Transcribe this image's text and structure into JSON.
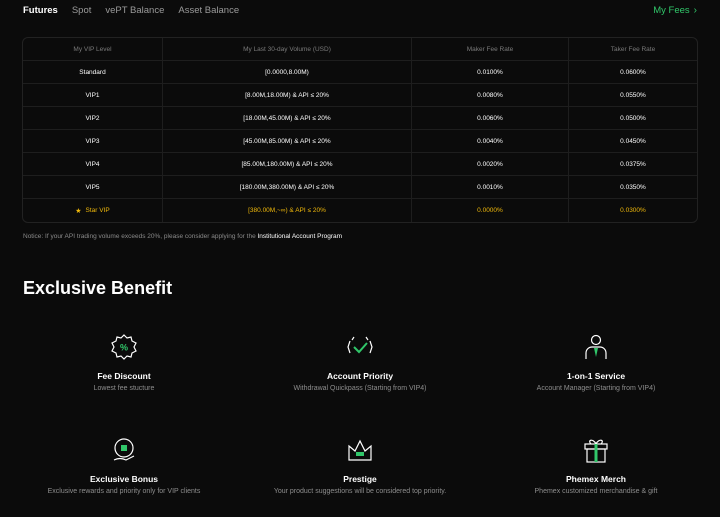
{
  "tabs": [
    "Futures",
    "Spot",
    "vePT Balance",
    "Asset Balance"
  ],
  "my_fees": "My Fees",
  "table": {
    "headers": [
      "My VIP Level",
      "My Last 30-day Volume (USD)",
      "Maker Fee Rate",
      "Taker Fee Rate"
    ],
    "rows": [
      [
        "Standard",
        "[0.0000,8.00M)",
        "0.0100%",
        "0.0600%"
      ],
      [
        "VIP1",
        "[8.00M,18.00M) & API ≤ 20%",
        "0.0080%",
        "0.0550%"
      ],
      [
        "VIP2",
        "[18.00M,45.00M) & API ≤ 20%",
        "0.0060%",
        "0.0500%"
      ],
      [
        "VIP3",
        "[45.00M,85.00M) & API ≤ 20%",
        "0.0040%",
        "0.0450%"
      ],
      [
        "VIP4",
        "[85.00M,180.00M) & API ≤ 20%",
        "0.0020%",
        "0.0375%"
      ],
      [
        "VIP5",
        "[180.00M,380.00M) & API ≤ 20%",
        "0.0010%",
        "0.0350%"
      ],
      [
        "Star VIP",
        "[380.00M,~∞) & API ≤ 20%",
        "0.0000%",
        "0.0300%"
      ]
    ]
  },
  "notice": {
    "text": "Notice: If your API trading volume exceeds 20%, please consider applying for the ",
    "link": "Institutional Account Program"
  },
  "section_title": "Exclusive Benefit",
  "benefits": [
    {
      "icon": "percent-badge-icon",
      "title": "Fee Discount",
      "sub": "Lowest fee stucture"
    },
    {
      "icon": "check-priority-icon",
      "title": "Account Priority",
      "sub": "Withdrawal Quickpass (Starting from VIP4)"
    },
    {
      "icon": "service-person-icon",
      "title": "1-on-1 Service",
      "sub": "Account Manager (Starting from VIP4)"
    },
    {
      "icon": "bonus-coin-icon",
      "title": "Exclusive Bonus",
      "sub": "Exclusive rewards and priority only for VIP clients"
    },
    {
      "icon": "crown-icon",
      "title": "Prestige",
      "sub": "Your product suggestions will be considered top priority."
    },
    {
      "icon": "gift-icon",
      "title": "Phemex Merch",
      "sub": "Phemex customized merchandise & gift"
    }
  ],
  "colors": {
    "accent": "#31c76a",
    "star": "#f0b90b",
    "background": "#0b0b0b"
  }
}
